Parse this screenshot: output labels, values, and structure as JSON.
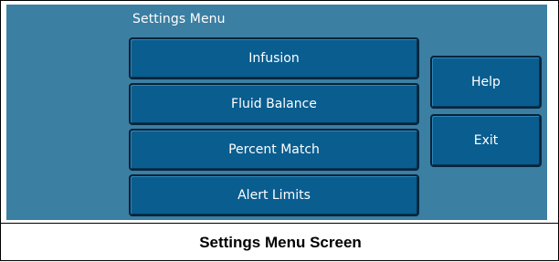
{
  "menu": {
    "title": "Settings Menu",
    "items": [
      {
        "label": "Infusion"
      },
      {
        "label": "Fluid Balance"
      },
      {
        "label": "Percent Match"
      },
      {
        "label": "Alert Limits"
      }
    ]
  },
  "side_buttons": {
    "help_label": "Help",
    "exit_label": "Exit"
  },
  "caption": "Settings Menu Screen",
  "colors": {
    "screen_background": "#3b7fa3",
    "button_fill": "#0a5d8f",
    "button_border": "#06233a",
    "text": "#ffffff"
  }
}
